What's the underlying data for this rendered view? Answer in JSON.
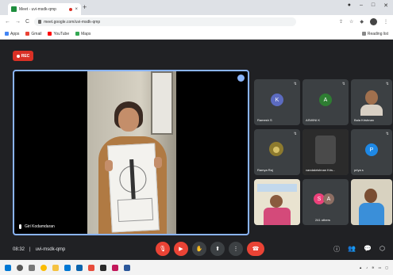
{
  "browser": {
    "tab_title": "Meet - uvi-msdk-qmp",
    "tab_close": "×",
    "new_tab": "+",
    "url": "meet.google.com/uvi-msdk-qmp",
    "back": "←",
    "forward": "→",
    "reload": "C",
    "bookmarks": [
      {
        "label": "Apps",
        "color": "#4285f4"
      },
      {
        "label": "Gmail",
        "color": "#ea4335"
      },
      {
        "label": "YouTube",
        "color": "#ff0000"
      },
      {
        "label": "Maps",
        "color": "#34a853"
      }
    ],
    "reading_list": "Reading list"
  },
  "meet": {
    "rec_label": "REC",
    "main_speaker_name": "Giri Kodamdaran",
    "meeting_time": "08:32",
    "meeting_code": "uvi-msdk-qmp",
    "tiles": [
      {
        "name": "Ramesh S",
        "initial": "K",
        "color": "#5c6bc0",
        "type": "avatar"
      },
      {
        "name": "ASWINI K",
        "initial": "A",
        "color": "#2e7d32",
        "type": "avatar"
      },
      {
        "name": "Bala Krishnan",
        "initial": "",
        "color": "",
        "type": "photo"
      },
      {
        "name": "Ramya Raj",
        "initial": "",
        "color": "",
        "type": "photo"
      },
      {
        "name": "vandakrishnan Kris...",
        "initial": "",
        "color": "",
        "type": "photo"
      },
      {
        "name": "priya s",
        "initial": "P",
        "color": "#1e88e5",
        "type": "avatar"
      },
      {
        "name": "",
        "initial": "",
        "color": "",
        "type": "photo"
      },
      {
        "name": "241 others",
        "initial": "",
        "color": "",
        "type": "others"
      },
      {
        "name": "",
        "initial": "",
        "color": "",
        "type": "photo"
      }
    ]
  },
  "colors": {
    "meet_bg": "#202124",
    "tile_bg": "#3c4043",
    "end_call": "#ea4335",
    "active_border": "#8ab4f8"
  }
}
